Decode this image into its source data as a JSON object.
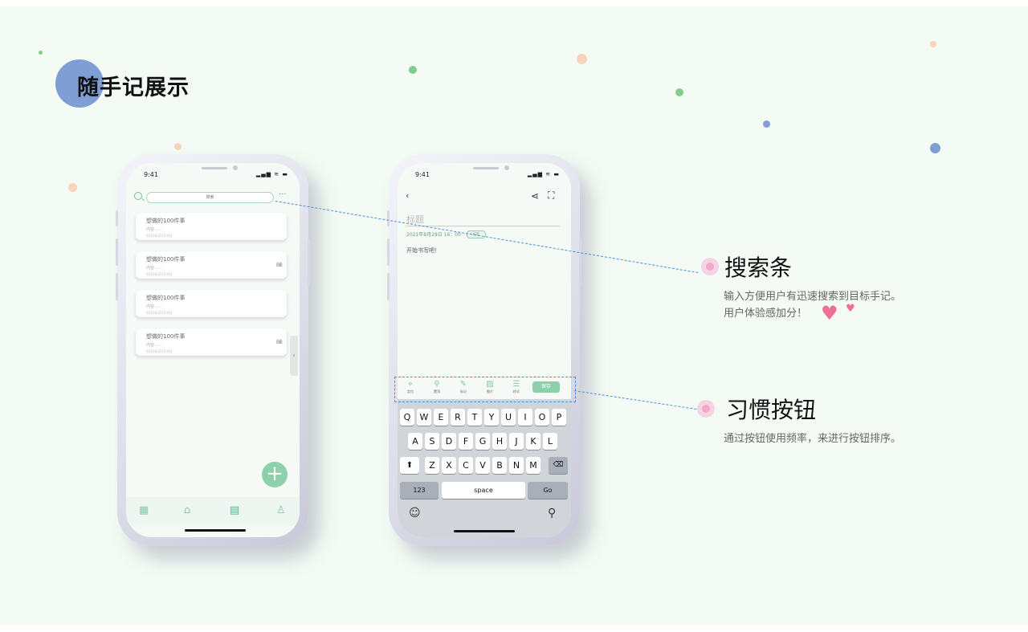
{
  "page": {
    "title": "随手记展示"
  },
  "phone_list": {
    "status_time": "9:41",
    "search_placeholder": "搜索",
    "more_label": "···",
    "notes": [
      {
        "title": "想做的100件事",
        "content": "内容......",
        "date": "2021年10月10日",
        "has_audio": false
      },
      {
        "title": "想做的100件事",
        "content": "内容......",
        "date": "2021年10月10日",
        "has_audio": true
      },
      {
        "title": "想做的100件事",
        "content": "内容......",
        "date": "2021年10月10日",
        "has_audio": false
      },
      {
        "title": "想做的100件事",
        "content": "内容......",
        "date": "2021年10月10日",
        "has_audio": true
      }
    ],
    "fab_label": "+",
    "nav_icons": [
      "calendar-icon",
      "home-icon",
      "notebook-icon",
      "user-icon"
    ]
  },
  "phone_editor": {
    "status_time": "9:41",
    "title_placeholder": "标题",
    "date": "2021年8月29日 16：00",
    "tag": "标签",
    "body_placeholder": "开始书写吧！",
    "tools": [
      {
        "icon": "location-icon",
        "label": "定位"
      },
      {
        "icon": "pin-icon",
        "label": "置顶"
      },
      {
        "icon": "pencil-icon",
        "label": "标记"
      },
      {
        "icon": "image-icon",
        "label": "图片"
      },
      {
        "icon": "list-icon",
        "label": "样式"
      }
    ],
    "save_label": "保存",
    "keyboard": {
      "row1": [
        "Q",
        "W",
        "E",
        "R",
        "T",
        "Y",
        "U",
        "I",
        "O",
        "P"
      ],
      "row2": [
        "A",
        "S",
        "D",
        "F",
        "G",
        "H",
        "J",
        "K",
        "L"
      ],
      "row3": [
        "Z",
        "X",
        "C",
        "V",
        "B",
        "N",
        "M"
      ],
      "numbers_key": "123",
      "space_key": "space",
      "go_key": "Go"
    }
  },
  "annotations": [
    {
      "title": "搜索条",
      "desc_lines": [
        "输入方便用户有迅速搜索到目标手记。",
        "用户体验感加分！"
      ]
    },
    {
      "title": "习惯按钮",
      "desc_lines": [
        "通过按钮使用频率，来进行按钮排序。"
      ]
    }
  ],
  "colors": {
    "accent": "#8dd1ac",
    "title_circle": "#7f9ed4",
    "dashed_line": "#4f8fd8",
    "annotation_dot": "#f0a9c8",
    "heart": "#ee6f98"
  }
}
